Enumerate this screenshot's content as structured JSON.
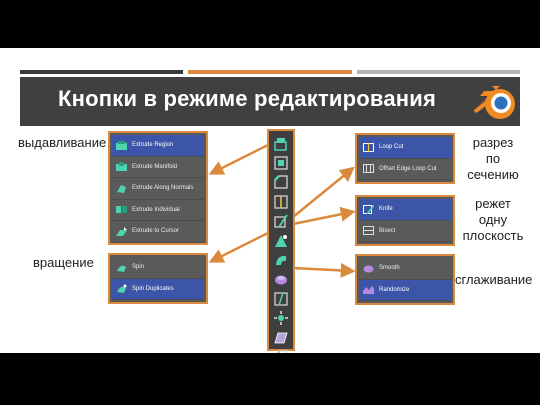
{
  "header": {
    "title": "Кнопки в режиме редактирования"
  },
  "labels": {
    "extrude": "выдавливание",
    "spin": "вращение",
    "loopcut": [
      "разрез",
      "по",
      "сечению"
    ],
    "knife": [
      "режет",
      "одну",
      "плоскость"
    ],
    "smooth": "сглаживание"
  },
  "panels": {
    "extrude": [
      "Extrude Region",
      "Extrude Manifold",
      "Extrude Along Normals",
      "Extrude Individual",
      "Extrude to Cursor"
    ],
    "spin": [
      "Spin",
      "Spin Duplicates"
    ],
    "loopcut": [
      "Loop Cut",
      "Offset Edge Loop Cut"
    ],
    "knife": [
      "Knife",
      "Bisect"
    ],
    "smooth": [
      "Smooth",
      "Randomize"
    ]
  },
  "toolbar_icons": [
    "extrude-icon",
    "inset-icon",
    "bevel-icon",
    "loop-cut-icon",
    "knife-icon",
    "poly-build-icon",
    "spin-icon",
    "smooth-icon",
    "edge-slide-icon",
    "shrink-fatten-icon",
    "shear-icon",
    "rip-icon"
  ],
  "colors": {
    "accent_orange": "#d98a3c",
    "selected_blue": "#3d55a8",
    "title_bar": "#404040",
    "panel_bg": "#5a5a5a"
  }
}
